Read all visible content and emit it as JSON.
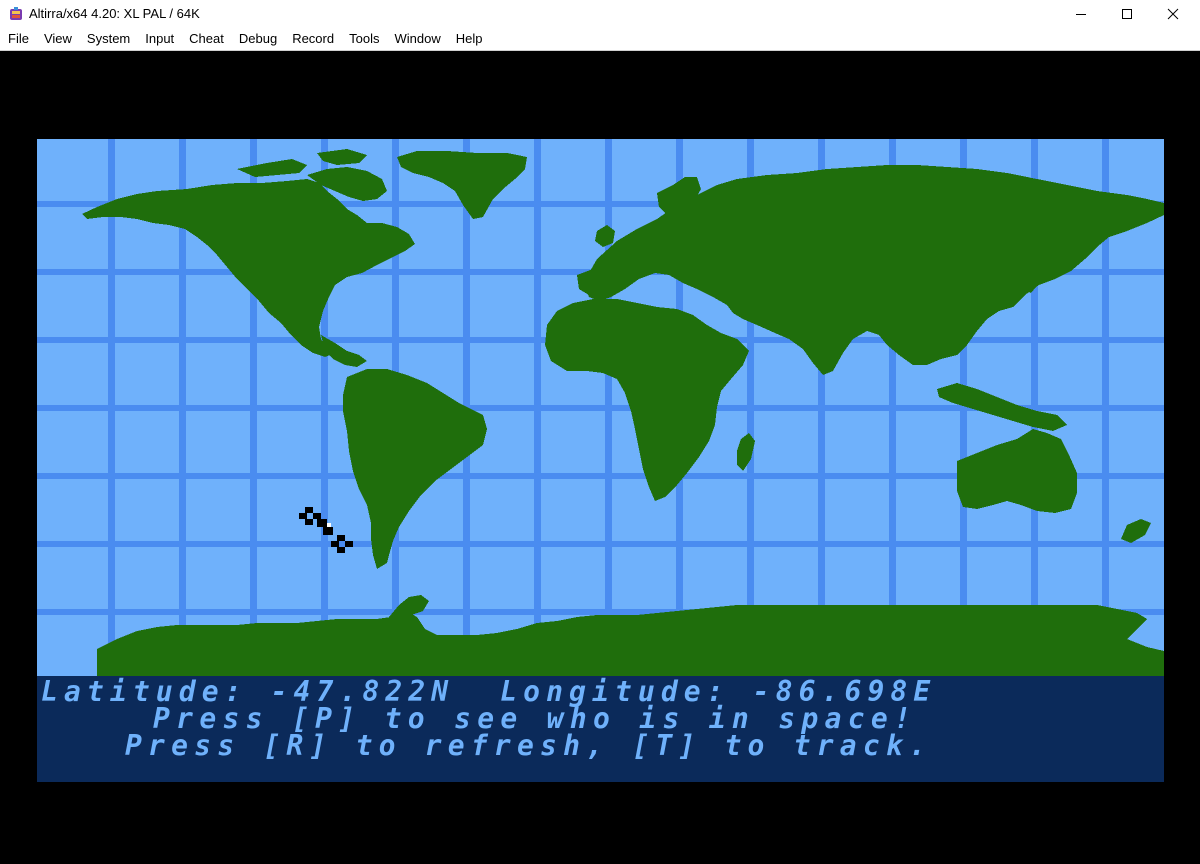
{
  "window": {
    "title": "Altirra/x64 4.20: XL PAL / 64K",
    "icon": "altirra-app-icon",
    "controls": [
      "minimize-icon",
      "maximize-icon",
      "close-icon"
    ]
  },
  "menu": [
    {
      "label": "File"
    },
    {
      "label": "View"
    },
    {
      "label": "System"
    },
    {
      "label": "Input"
    },
    {
      "label": "Cheat"
    },
    {
      "label": "Debug"
    },
    {
      "label": "Record"
    },
    {
      "label": "Tools"
    },
    {
      "label": "Window"
    },
    {
      "label": "Help"
    }
  ],
  "emulator": {
    "colors": {
      "ocean": "#6fb1fb",
      "grid": "#4a8cf0",
      "land": "#1f6e0c",
      "status_bg": "#0b2a5a",
      "status_text": "#6fb1fb",
      "satellite": "#000000"
    },
    "satellite_icon": "satellite-icon",
    "status": {
      "line1": "Latitude: -47.822N  Longitude: -86.698E",
      "line2": "Press [P] to see who is in space!",
      "line3": "Press [R] to refresh, [T] to track."
    }
  }
}
